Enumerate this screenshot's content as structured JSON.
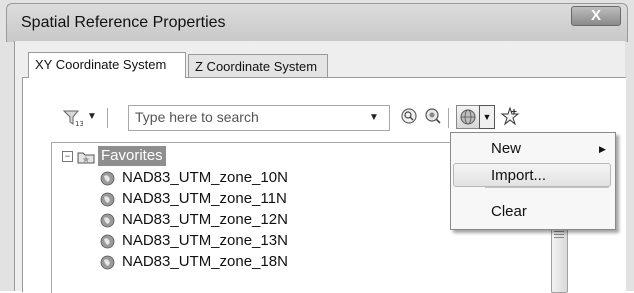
{
  "window": {
    "title": "Spatial Reference Properties",
    "close_label": "X"
  },
  "tabs": [
    {
      "label": "XY Coordinate System",
      "active": true
    },
    {
      "label": "Z Coordinate System",
      "active": false
    }
  ],
  "toolbar": {
    "search_placeholder": "Type here to search",
    "icons": [
      "filter-icon",
      "search-icon",
      "zoom-to-extent-icon",
      "globe-icon",
      "dropdown-arrow-icon",
      "add-favorite-star-icon"
    ]
  },
  "tree": {
    "root_label": "Favorites",
    "items": [
      "NAD83_UTM_zone_10N",
      "NAD83_UTM_zone_11N",
      "NAD83_UTM_zone_12N",
      "NAD83_UTM_zone_13N",
      "NAD83_UTM_zone_18N"
    ]
  },
  "context_menu": {
    "items": [
      {
        "label": "New",
        "has_submenu": true
      },
      {
        "label": "Import...",
        "highlighted": true
      },
      {
        "label": "Clear"
      }
    ]
  }
}
